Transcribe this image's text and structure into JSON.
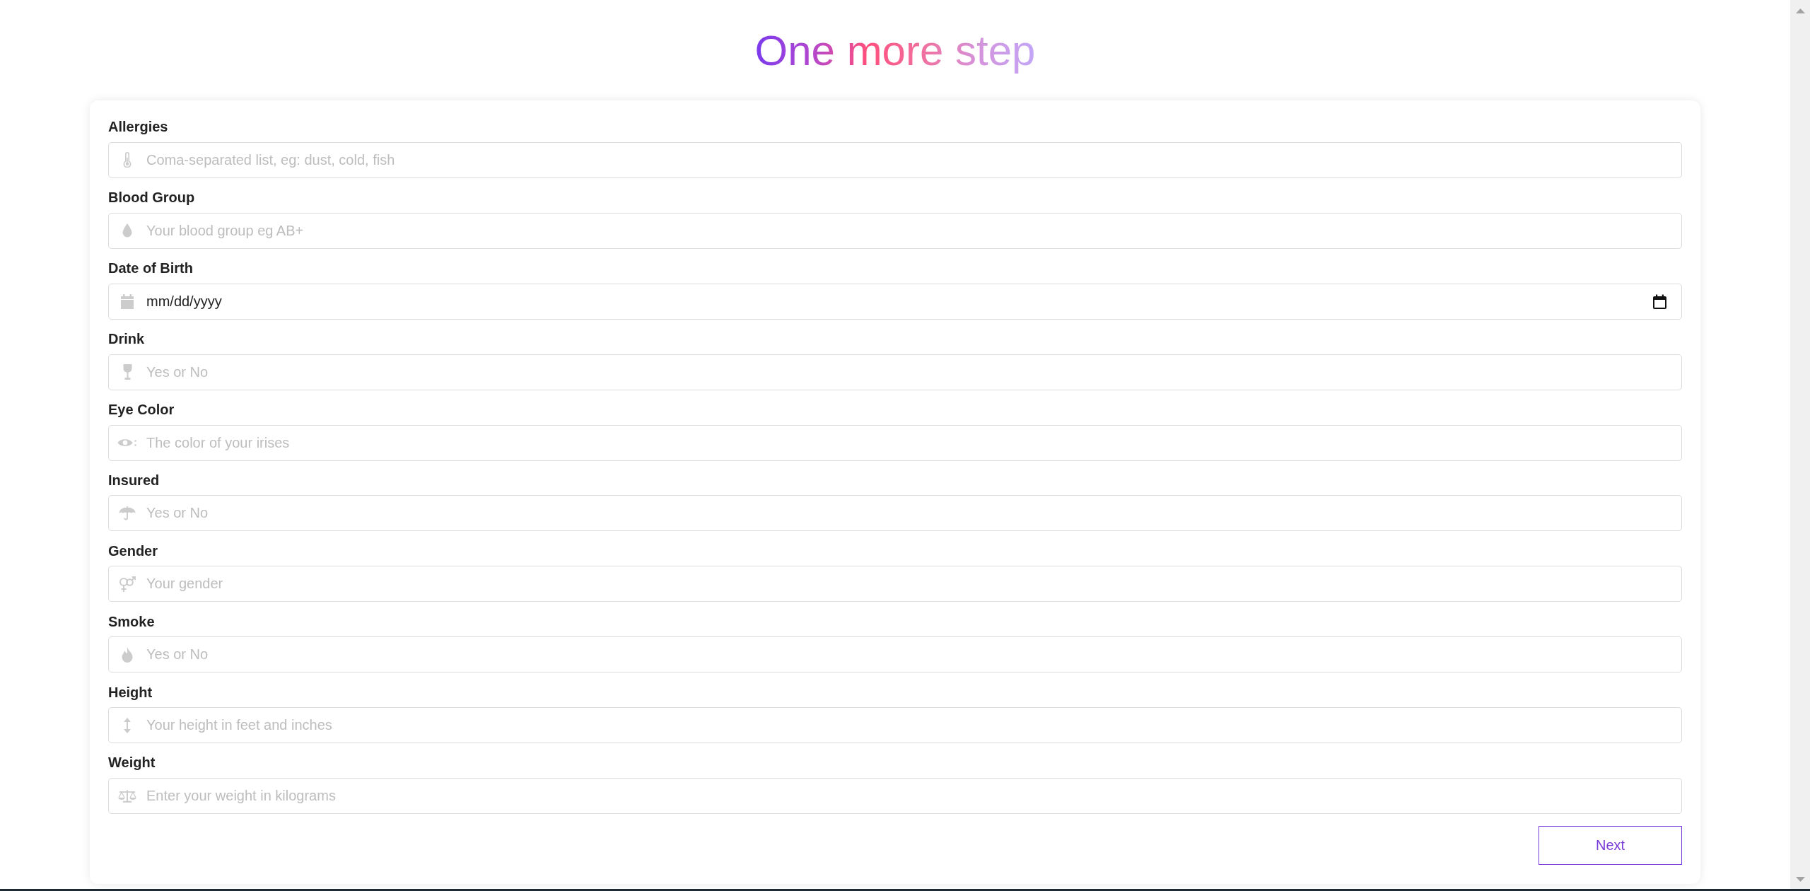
{
  "title": "One more step",
  "fields": [
    {
      "label": "Allergies",
      "kind": "text",
      "placeholder": "Coma-separated list, eg: dust, cold, fish"
    },
    {
      "label": "Blood Group",
      "kind": "text",
      "placeholder": "Your blood group eg AB+"
    },
    {
      "label": "Date of Birth",
      "kind": "date",
      "placeholder": "mm/dd/yyyy"
    },
    {
      "label": "Drink",
      "kind": "text",
      "placeholder": "Yes or No"
    },
    {
      "label": "Eye Color",
      "kind": "text",
      "placeholder": "The color of your irises"
    },
    {
      "label": "Insured",
      "kind": "text",
      "placeholder": "Yes or No"
    },
    {
      "label": "Gender",
      "kind": "text",
      "placeholder": "Your gender"
    },
    {
      "label": "Smoke",
      "kind": "text",
      "placeholder": "Yes or No"
    },
    {
      "label": "Height",
      "kind": "text",
      "placeholder": "Your height in feet and inches"
    },
    {
      "label": "Weight",
      "kind": "text",
      "placeholder": "Enter your weight in kilograms"
    }
  ],
  "submit_button": "Next"
}
